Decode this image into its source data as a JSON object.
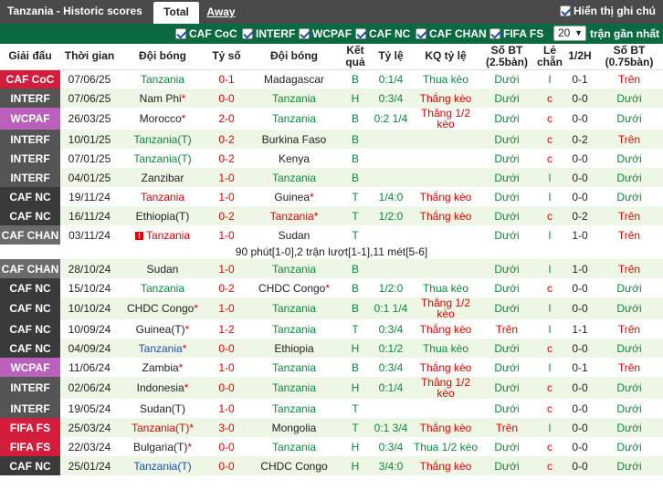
{
  "header": {
    "title": "Tanzania - Historic scores",
    "tab_total": "Total",
    "tab_away": "Away",
    "show_notes_label": "Hiển thị ghi chú"
  },
  "filters": {
    "options": [
      "CAF CoC",
      "INTERF",
      "WCPAF",
      "CAF NC",
      "CAF CHAN",
      "FIFA FS"
    ],
    "recent_value": "20",
    "recent_label": "trận gần nhất"
  },
  "columns": [
    "Giải đấu",
    "Thời gian",
    "Đội bóng",
    "Tỷ số",
    "Đội bóng",
    "Kết quả",
    "Tỷ lệ",
    "KQ tỷ lệ",
    "Số BT (2.5bàn)",
    "Lẻ chẵn",
    "1/2H",
    "Số BT (0.75bàn)"
  ],
  "colors": {
    "highlight_team": "#0a8a3a",
    "red": "#e60000",
    "blue": "#1a4fb0",
    "league_CAF CoC": "#d21e3c",
    "league_INTERF": "#555555",
    "league_WCPAF": "#bb5fbd",
    "league_CAF NC": "#3a3a3a",
    "league_CAF CHAN": "#6b6b6b",
    "league_FIFA FS": "#d21e3c"
  },
  "rows": [
    {
      "league": "CAF CoC",
      "date": "07/06/25",
      "home": "Tanzania",
      "home_mark": "",
      "score": "0-1",
      "away": "Madagascar",
      "away_mark": "",
      "hl": "home",
      "result": "B",
      "handicap": "0:1/4",
      "hres": "Thua kèo",
      "hres_cls": "hl",
      "ou": "Dưới",
      "ou_cls": "hl",
      "oe": "l",
      "oe_cls": "hl",
      "ht": "0-1",
      "ou75": "Trên",
      "ou75_cls": "red"
    },
    {
      "league": "INTERF",
      "date": "07/06/25",
      "home": "Nam Phi",
      "home_mark": "*",
      "score": "0-0",
      "away": "Tanzania",
      "away_mark": "",
      "hl": "away",
      "result": "H",
      "handicap": "0:3/4",
      "hres": "Thắng kèo",
      "hres_cls": "red",
      "ou": "Dưới",
      "ou_cls": "hl",
      "oe": "c",
      "oe_cls": "red",
      "ht": "0-0",
      "ou75": "Dưới",
      "ou75_cls": "hl"
    },
    {
      "league": "WCPAF",
      "date": "26/03/25",
      "home": "Morocco",
      "home_mark": "*",
      "score": "2-0",
      "away": "Tanzania",
      "away_mark": "",
      "hl": "away",
      "result": "B",
      "handicap": "0:2 1/4",
      "hres": "Thắng 1/2 kèo",
      "hres_cls": "red",
      "ou": "Dưới",
      "ou_cls": "hl",
      "oe": "c",
      "oe_cls": "red",
      "ht": "0-0",
      "ou75": "Dưới",
      "ou75_cls": "hl"
    },
    {
      "league": "INTERF",
      "date": "10/01/25",
      "home": "Tanzania(T)",
      "home_mark": "",
      "score": "0-2",
      "away": "Burkina Faso",
      "away_mark": "",
      "hl": "home",
      "result": "B",
      "handicap": "",
      "hres": "",
      "hres_cls": "hl",
      "ou": "Dưới",
      "ou_cls": "hl",
      "oe": "c",
      "oe_cls": "red",
      "ht": "0-2",
      "ou75": "Trên",
      "ou75_cls": "red"
    },
    {
      "league": "INTERF",
      "date": "07/01/25",
      "home": "Tanzania(T)",
      "home_mark": "",
      "score": "0-2",
      "away": "Kenya",
      "away_mark": "",
      "hl": "home",
      "result": "B",
      "handicap": "",
      "hres": "",
      "hres_cls": "hl",
      "ou": "Dưới",
      "ou_cls": "hl",
      "oe": "c",
      "oe_cls": "red",
      "ht": "0-0",
      "ou75": "Dưới",
      "ou75_cls": "hl"
    },
    {
      "league": "INTERF",
      "date": "04/01/25",
      "home": "Zanzibar",
      "home_mark": "",
      "score": "1-0",
      "away": "Tanzania",
      "away_mark": "",
      "hl": "away",
      "result": "B",
      "handicap": "",
      "hres": "",
      "hres_cls": "hl",
      "ou": "Dưới",
      "ou_cls": "hl",
      "oe": "l",
      "oe_cls": "hl",
      "ht": "0-0",
      "ou75": "Dưới",
      "ou75_cls": "hl"
    },
    {
      "league": "CAF NC",
      "date": "19/11/24",
      "home": "Tanzania",
      "home_mark": "",
      "score": "1-0",
      "away": "Guinea",
      "away_mark": "*",
      "hl": "home_red",
      "result": "T",
      "handicap": "1/4:0",
      "hres": "Thắng kèo",
      "hres_cls": "red",
      "ou": "Dưới",
      "ou_cls": "hl",
      "oe": "l",
      "oe_cls": "hl",
      "ht": "0-0",
      "ou75": "Dưới",
      "ou75_cls": "hl"
    },
    {
      "league": "CAF NC",
      "date": "16/11/24",
      "home": "Ethiopia(T)",
      "home_mark": "",
      "score": "0-2",
      "away": "Tanzania",
      "away_mark": "*",
      "hl": "away_red",
      "result": "T",
      "handicap": "1/2:0",
      "hres": "Thắng kèo",
      "hres_cls": "red",
      "ou": "Dưới",
      "ou_cls": "hl",
      "oe": "c",
      "oe_cls": "red",
      "ht": "0-2",
      "ou75": "Trên",
      "ou75_cls": "red"
    },
    {
      "league": "CAF CHAN",
      "date": "03/11/24",
      "home": "Tanzania",
      "home_mark": "",
      "score": "1-0",
      "away": "Sudan",
      "away_mark": "",
      "hl": "home_red_warn",
      "result": "T",
      "handicap": "",
      "hres": "",
      "hres_cls": "hl",
      "ou": "Dưới",
      "ou_cls": "hl",
      "oe": "l",
      "oe_cls": "hl",
      "ht": "1-0",
      "ou75": "Trên",
      "ou75_cls": "red"
    },
    {
      "note": "90 phút[1-0],2 trận lượt[1-1],11 mét[5-6]"
    },
    {
      "league": "CAF CHAN",
      "date": "28/10/24",
      "home": "Sudan",
      "home_mark": "",
      "score": "1-0",
      "away": "Tanzania",
      "away_mark": "",
      "hl": "away",
      "result": "B",
      "handicap": "",
      "hres": "",
      "hres_cls": "hl",
      "ou": "Dưới",
      "ou_cls": "hl",
      "oe": "l",
      "oe_cls": "hl",
      "ht": "1-0",
      "ou75": "Trên",
      "ou75_cls": "red"
    },
    {
      "league": "CAF NC",
      "date": "15/10/24",
      "home": "Tanzania",
      "home_mark": "",
      "score": "0-2",
      "away": "CHDC Congo",
      "away_mark": "*",
      "hl": "home",
      "result": "B",
      "handicap": "1/2:0",
      "hres": "Thua kèo",
      "hres_cls": "hl",
      "ou": "Dưới",
      "ou_cls": "hl",
      "oe": "c",
      "oe_cls": "red",
      "ht": "0-0",
      "ou75": "Dưới",
      "ou75_cls": "hl"
    },
    {
      "league": "CAF NC",
      "date": "10/10/24",
      "home": "CHDC Congo",
      "home_mark": "*",
      "score": "1-0",
      "away": "Tanzania",
      "away_mark": "",
      "hl": "away",
      "result": "B",
      "handicap": "0:1 1/4",
      "hres": "Thắng 1/2 kèo",
      "hres_cls": "red",
      "ou": "Dưới",
      "ou_cls": "hl",
      "oe": "l",
      "oe_cls": "hl",
      "ht": "0-0",
      "ou75": "Dưới",
      "ou75_cls": "hl"
    },
    {
      "league": "CAF NC",
      "date": "10/09/24",
      "home": "Guinea(T)",
      "home_mark": "*",
      "score": "1-2",
      "away": "Tanzania",
      "away_mark": "",
      "hl": "away",
      "result": "T",
      "handicap": "0:3/4",
      "hres": "Thắng kèo",
      "hres_cls": "red",
      "ou": "Trên",
      "ou_cls": "red",
      "oe": "l",
      "oe_cls": "hl",
      "ht": "1-1",
      "ou75": "Trên",
      "ou75_cls": "red"
    },
    {
      "league": "CAF NC",
      "date": "04/09/24",
      "home": "Tanzania",
      "home_mark": "*",
      "score": "0-0",
      "away": "Ethiopia",
      "away_mark": "",
      "hl": "home_blue",
      "result": "H",
      "handicap": "0:1/2",
      "hres": "Thua kèo",
      "hres_cls": "hl",
      "ou": "Dưới",
      "ou_cls": "hl",
      "oe": "c",
      "oe_cls": "red",
      "ht": "0-0",
      "ou75": "Dưới",
      "ou75_cls": "hl"
    },
    {
      "league": "WCPAF",
      "date": "11/06/24",
      "home": "Zambia",
      "home_mark": "*",
      "score": "1-0",
      "away": "Tanzania",
      "away_mark": "",
      "hl": "away",
      "result": "B",
      "handicap": "0:3/4",
      "hres": "Thắng kèo",
      "hres_cls": "red",
      "ou": "Dưới",
      "ou_cls": "hl",
      "oe": "l",
      "oe_cls": "hl",
      "ht": "0-1",
      "ou75": "Trên",
      "ou75_cls": "red"
    },
    {
      "league": "INTERF",
      "date": "02/06/24",
      "home": "Indonesia",
      "home_mark": "*",
      "score": "0-0",
      "away": "Tanzania",
      "away_mark": "",
      "hl": "away",
      "result": "H",
      "handicap": "0:1/4",
      "hres": "Thắng 1/2 kèo",
      "hres_cls": "red",
      "ou": "Dưới",
      "ou_cls": "hl",
      "oe": "c",
      "oe_cls": "red",
      "ht": "0-0",
      "ou75": "Dưới",
      "ou75_cls": "hl"
    },
    {
      "league": "INTERF",
      "date": "19/05/24",
      "home": "Sudan(T)",
      "home_mark": "",
      "score": "1-0",
      "away": "Tanzania",
      "away_mark": "",
      "hl": "away",
      "result": "T",
      "handicap": "",
      "hres": "",
      "hres_cls": "hl",
      "ou": "Dưới",
      "ou_cls": "hl",
      "oe": "c",
      "oe_cls": "red",
      "ht": "0-0",
      "ou75": "Dưới",
      "ou75_cls": "hl"
    },
    {
      "league": "FIFA FS",
      "date": "25/03/24",
      "home": "Tanzania(T)",
      "home_mark": "*",
      "score": "3-0",
      "away": "Mongolia",
      "away_mark": "",
      "hl": "home_red",
      "result": "T",
      "handicap": "0:1 3/4",
      "hres": "Thắng kèo",
      "hres_cls": "red",
      "ou": "Trên",
      "ou_cls": "red",
      "oe": "l",
      "oe_cls": "hl",
      "ht": "0-0",
      "ou75": "Dưới",
      "ou75_cls": "hl"
    },
    {
      "league": "FIFA FS",
      "date": "22/03/24",
      "home": "Bulgaria(T)",
      "home_mark": "*",
      "score": "0-0",
      "away": "Tanzania",
      "away_mark": "",
      "hl": "away",
      "result": "H",
      "handicap": "0:3/4",
      "hres": "Thua 1/2 kèo",
      "hres_cls": "hl",
      "ou": "Dưới",
      "ou_cls": "hl",
      "oe": "c",
      "oe_cls": "red",
      "ht": "0-0",
      "ou75": "Dưới",
      "ou75_cls": "hl"
    },
    {
      "league": "CAF NC",
      "date": "25/01/24",
      "home": "Tanzania(T)",
      "home_mark": "",
      "score": "0-0",
      "away": "CHDC Congo",
      "away_mark": "",
      "hl": "home_blue",
      "result": "H",
      "handicap": "3/4:0",
      "hres": "Thắng kèo",
      "hres_cls": "red",
      "ou": "Dưới",
      "ou_cls": "hl",
      "oe": "c",
      "oe_cls": "red",
      "ht": "0-0",
      "ou75": "Dưới",
      "ou75_cls": "hl"
    }
  ]
}
